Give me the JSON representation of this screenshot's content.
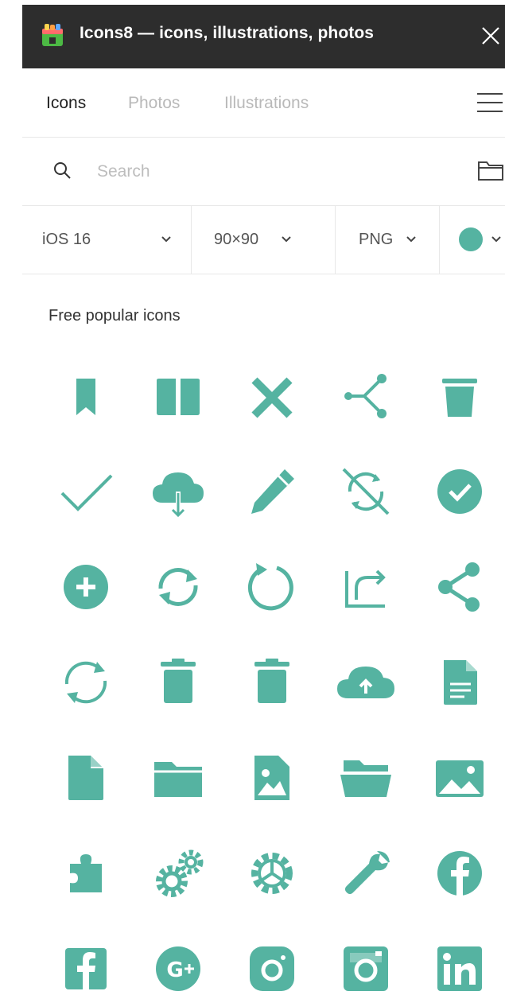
{
  "window": {
    "title": "Icons8 — icons, illustrations, photos"
  },
  "tabs": [
    {
      "label": "Icons",
      "active": true
    },
    {
      "label": "Photos",
      "active": false
    },
    {
      "label": "Illustrations",
      "active": false
    }
  ],
  "search": {
    "placeholder": "Search",
    "value": ""
  },
  "filters": {
    "style": "iOS 16",
    "size": "90×90",
    "format": "PNG",
    "color": "#55b3a1"
  },
  "section": {
    "title": "Free popular icons"
  },
  "colors": {
    "accent": "#55b3a1",
    "titlebar": "#2d2d2d"
  },
  "icons": [
    "bookmark-icon",
    "book-icon",
    "close-icon",
    "share-node-icon",
    "trash-icon",
    "checkmark-icon",
    "cloud-download-icon",
    "pencil-icon",
    "sync-off-icon",
    "check-circle-icon",
    "plus-circle-icon",
    "refresh-icon",
    "rotate-icon",
    "export-icon",
    "share-icon",
    "sync-icon",
    "delete-icon",
    "trash-bin-icon",
    "cloud-upload-icon",
    "document-icon",
    "file-icon",
    "folder-icon",
    "image-file-icon",
    "open-folder-icon",
    "picture-icon",
    "puzzle-icon",
    "gears-icon",
    "settings-icon",
    "wrench-icon",
    "facebook-circle-icon",
    "facebook-icon",
    "google-plus-icon",
    "instagram-icon",
    "instagram-old-icon",
    "linkedin-icon"
  ]
}
